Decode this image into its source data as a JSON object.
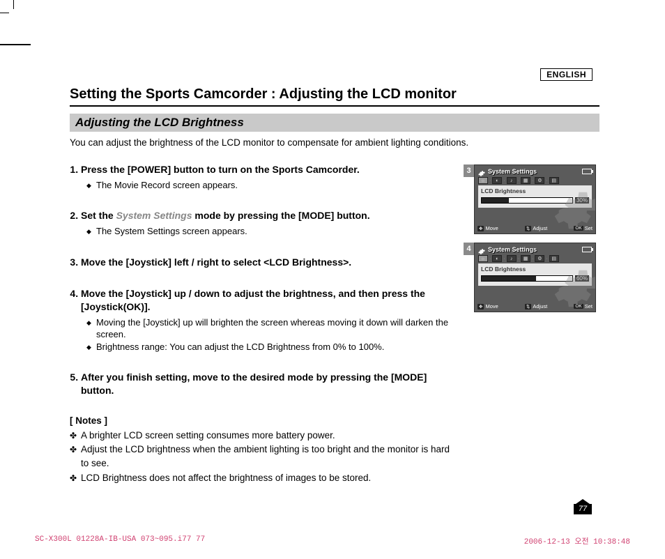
{
  "language": "ENGLISH",
  "title": "Setting the Sports Camcorder : Adjusting the LCD monitor",
  "subtitle": "Adjusting the LCD Brightness",
  "intro": "You can adjust the brightness of the LCD monitor to compensate for ambient lighting conditions.",
  "steps": [
    {
      "text_before": "Press the [POWER] button to turn on the Sports Camcorder.",
      "emph": "",
      "text_after": "",
      "sub": [
        "The Movie Record screen appears."
      ]
    },
    {
      "text_before": "Set the ",
      "emph": "System Settings",
      "text_after": " mode by pressing the [MODE] button.",
      "sub": [
        "The System Settings screen appears."
      ]
    },
    {
      "text_before": "Move the [Joystick] left / right to select <LCD Brightness>.",
      "emph": "",
      "text_after": "",
      "sub": []
    },
    {
      "text_before": "Move the [Joystick] up / down to adjust the brightness, and then press the [Joystick(OK)].",
      "emph": "",
      "text_after": "",
      "sub": [
        "Moving the [Joystick] up will brighten the screen whereas moving it down will darken the screen.",
        "Brightness range: You can adjust the LCD Brightness from 0% to 100%."
      ]
    },
    {
      "text_before": "After you finish setting, move to the desired mode by pressing the [MODE] button.",
      "emph": "",
      "text_after": "",
      "sub": []
    }
  ],
  "notes_title": "[ Notes ]",
  "notes": [
    "A brighter LCD screen setting consumes more battery power.",
    "Adjust the LCD brightness when the ambient lighting is too bright and the monitor is hard to see.",
    "LCD Brightness does not affect the brightness of images to be stored."
  ],
  "page_number": "77",
  "footer": {
    "left": "SC-X300L 01228A-IB-USA 073~095.i77   77",
    "right": "2006-12-13   오전 10:38:48"
  },
  "lcd": {
    "header": "System Settings",
    "label": "LCD Brightness",
    "move": "Move",
    "adjust": "Adjust",
    "set": "Set",
    "ok": "OK",
    "screens": [
      {
        "tab": "3",
        "pct_label": "30%",
        "pct_value": 30
      },
      {
        "tab": "4",
        "pct_label": "60%",
        "pct_value": 60
      }
    ]
  }
}
